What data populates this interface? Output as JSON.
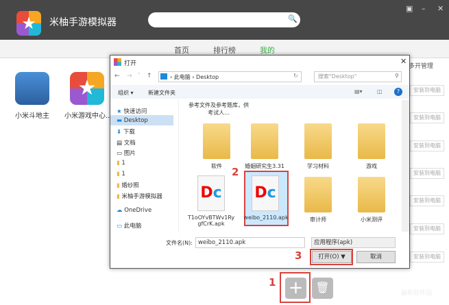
{
  "app": {
    "title": "米柚手游模拟器",
    "logo_icon": "star-icon",
    "window_controls": [
      "restore-icon",
      "minimize-icon",
      "close-icon"
    ]
  },
  "nav": {
    "items": [
      "首页",
      "排行榜",
      "我的"
    ],
    "active": "我的",
    "active_color": "#3fae49"
  },
  "games": [
    {
      "name": "小米斗地主"
    },
    {
      "name": "小米游戏中心..."
    }
  ],
  "right": {
    "header": "多开管理",
    "install_buttons": [
      "安装到电脑",
      "安装到电脑",
      "安装到电脑",
      "安装到电脑",
      "安装到电脑",
      "安装到电脑",
      "安装到电脑"
    ]
  },
  "dialog": {
    "title": "打开",
    "path": [
      "此电脑",
      "Desktop"
    ],
    "search_placeholder": "搜索\"Desktop\"",
    "organize": "组织 ▾",
    "new_folder": "新建文件夹",
    "nav_pane": [
      "快速访问",
      "Desktop",
      "下载",
      "文档",
      "图片",
      "1",
      "1",
      "婚纱照",
      "米柚手游模拟器",
      "OneDrive",
      "此电脑"
    ],
    "top_item": "参考文件及参考题库，供考试人...",
    "files": [
      {
        "name": "软件",
        "type": "folder"
      },
      {
        "name": "婚姻研究生3.31",
        "type": "folder"
      },
      {
        "name": "学习材料",
        "type": "folder"
      },
      {
        "name": "游戏",
        "type": "folder"
      },
      {
        "name": "T1oOYvBTWv1RygfCrK.apk",
        "type": "apk"
      },
      {
        "name": "weibo_2110.apk",
        "type": "apk",
        "selected": true
      },
      {
        "name": "审计师",
        "type": "folder"
      },
      {
        "name": "小米测评",
        "type": "folder"
      }
    ],
    "filename_label": "文件名(N):",
    "filename_value": "weibo_2110.apk",
    "filetype": "应用程序(apk)",
    "open_button": "打开(O)",
    "cancel_button": "取消"
  },
  "steps": [
    "1",
    "2",
    "3"
  ],
  "watermark": "最新软件园"
}
